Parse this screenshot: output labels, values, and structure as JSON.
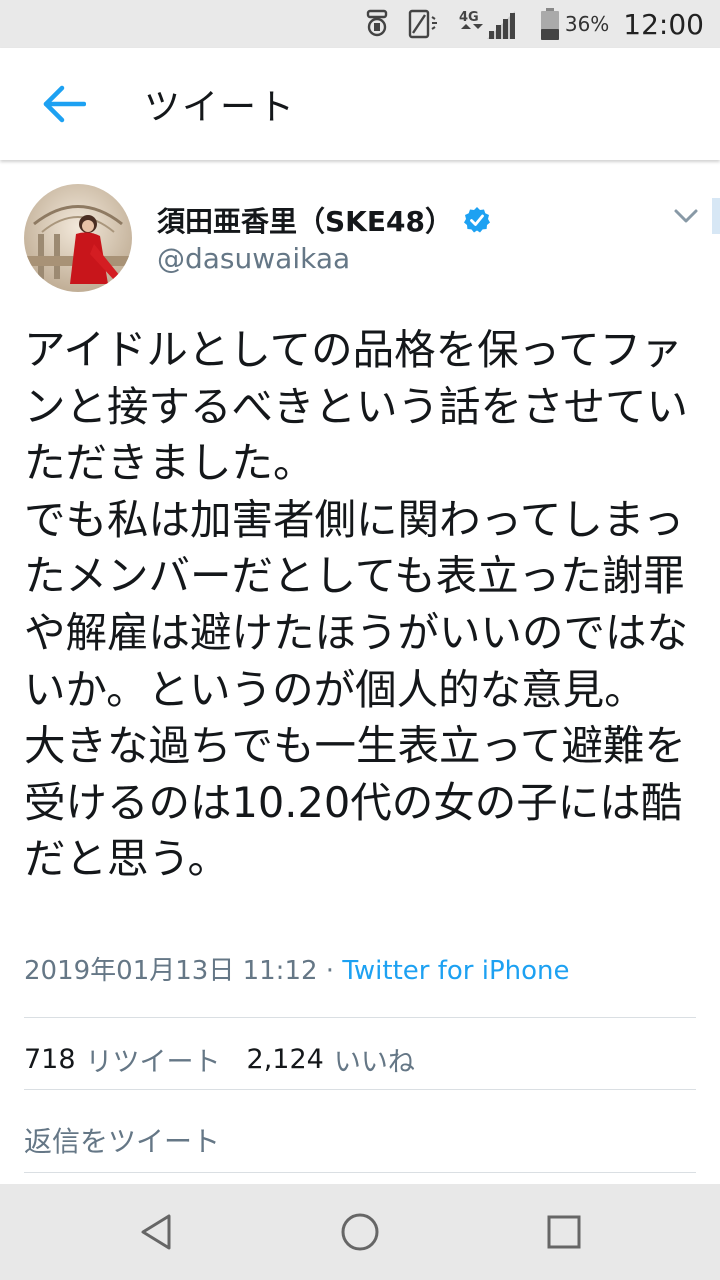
{
  "status_bar": {
    "network": "4G",
    "battery_percent": "36%",
    "time": "12:00",
    "icons": [
      "alarm-icon",
      "vibrate-icon",
      "signal-icon",
      "battery-icon"
    ]
  },
  "app_bar": {
    "back_icon": "arrow-left-icon",
    "title": "ツイート",
    "accent_color": "#1da1f2"
  },
  "tweet": {
    "author_name": "須田亜香里（SKE48）",
    "verified": true,
    "handle": "@dasuwaikaa",
    "text": "アイドルとしての品格を保ってファンと接するべきという話をさせていただきました。\nでも私は加害者側に関わってしまったメンバーだとしても表立った謝罪や解雇は避けたほうがいいのではないか。というのが個人的な意見。\n大きな過ちでも一生表立って避難を受けるのは10.20代の女の子には酷だと思う。",
    "timestamp": "2019年01月13日 11:12",
    "separator": " · ",
    "source": "Twitter for iPhone"
  },
  "stats": {
    "retweets_count": "718",
    "retweets_label": "リツイート",
    "likes_count": "2,124",
    "likes_label": "いいね"
  },
  "reply": {
    "placeholder": "返信をツイート"
  },
  "nav_bar": {
    "icons": [
      "back-triangle-icon",
      "home-circle-icon",
      "recents-square-icon"
    ]
  }
}
